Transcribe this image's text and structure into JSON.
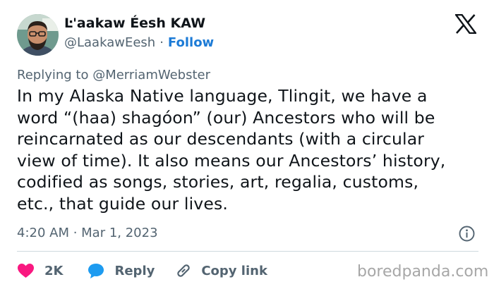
{
  "author": {
    "name": "Ŀ'aakaw Éesh KAW",
    "handle": "@LaakawEesh",
    "separator": "·",
    "follow_label": "Follow"
  },
  "reply_context": "Replying to @MerriamWebster",
  "tweet": {
    "lines": [
      "In my Alaska Native language, Tlingit, we have a",
      "word “(haa) shagóon” (our) Ancestors who will be",
      "reincarnated as our descendants (with a circular",
      "view of time). It also means our Ancestors’ history,",
      "codified as songs, stories, art, regalia, customs,",
      "etc., that guide our lives."
    ]
  },
  "timestamp": "4:20 AM · Mar 1, 2023",
  "actions": {
    "likes": "2K",
    "reply_label": "Reply",
    "copy_link_label": "Copy link"
  },
  "watermark": "boredpanda.com",
  "icons": {
    "platform": "x-logo-icon",
    "info": "info-icon",
    "like": "heart-icon",
    "reply": "speech-bubble-icon",
    "link": "link-icon"
  },
  "colors": {
    "text": "#0f1419",
    "secondary": "#536471",
    "link": "#1d7bd6",
    "heart": "#f91880",
    "reply_bubble": "#1d9bf0",
    "divider": "#cfd9de",
    "watermark": "#a7a7a7"
  }
}
